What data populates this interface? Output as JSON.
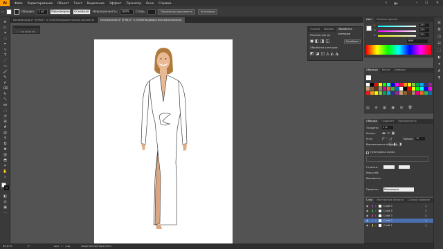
{
  "app": {
    "logo": "Ai"
  },
  "menu": [
    "Файл",
    "Редактирование",
    "Объект",
    "Текст",
    "Выделение",
    "Эффект",
    "Просмотр",
    "Окно",
    "Справка"
  ],
  "control_bar": {
    "stroke_label": "Обводка:",
    "stroke_value": "1 pt",
    "stroke_style": "Равномерно",
    "brush": "Основная",
    "opacity_label": "Непрозрачность:",
    "opacity_value": "100%",
    "style_label": "Стиль:",
    "doc_settings_button": "Параметры документа",
    "prefs_button": "Установки"
  },
  "tabs": [
    {
      "label": "Безымянный-2* @ 66,67 % (RGB/Предварительный просмотр)",
      "active": false
    },
    {
      "label": "Безымянный-4* @ 66,67 % (RGB/Предварительный просмотр)",
      "active": true
    }
  ],
  "float_panel": {
    "title": "··"
  },
  "pathfinder": {
    "tabs": [
      "Трансф",
      "Выравн",
      "Обработка контуров"
    ],
    "shape_modes_label": "Режимы фигур:",
    "expand_button": "Разобрать",
    "pathfinders_label": "Обработка контуров:"
  },
  "color_panel": {
    "tabs": [
      "Цвет",
      "Каталог цветов"
    ],
    "channels": [
      {
        "name": "R",
        "value": "255",
        "color": "#ff4444"
      },
      {
        "name": "G",
        "value": "255",
        "color": "#44ff44"
      },
      {
        "name": "B",
        "value": "255",
        "color": "#4488ff"
      }
    ],
    "hex": "ffffff"
  },
  "swatches_panel": {
    "tabs": [
      "Образцы",
      "Кисти",
      "Символы"
    ]
  },
  "stroke_panel": {
    "tabs": [
      "Обводка",
      "Градиент",
      "Прозрачность"
    ],
    "weight_label": "Толщина:",
    "weight_value": "1 pt",
    "cap_label": "Концы:",
    "corner_label": "Угол:",
    "limit_label": "Предел:",
    "limit_value": "10",
    "align_label": "Выравнивание обводки:",
    "dashed_label": "Пунктирная линия",
    "arrowheads_label": "Стрелки:",
    "scale_label": "Масштаб:",
    "align2_label": "Выравнить:",
    "profile_label": "Профиль:",
    "profile_value": "Равномерно"
  },
  "layers_panel": {
    "tabs": [
      "Слои",
      "Монтажные области",
      "Ссылки графики"
    ],
    "layers": [
      "Слой 5",
      "Слой 4",
      "Слой 3",
      "Слой 2",
      "Слой 1"
    ],
    "selected_index": 3
  },
  "status_bar": {
    "zoom": "66,67%",
    "angle": "0°",
    "page": "1",
    "tool_name": "Выделенный фрагмент"
  },
  "colors": {
    "ui_dark": "#323232",
    "panel": "#3a3a3a",
    "canvas": "#535353",
    "accent": "#ff9a00",
    "selection": "#4b6eaf"
  }
}
